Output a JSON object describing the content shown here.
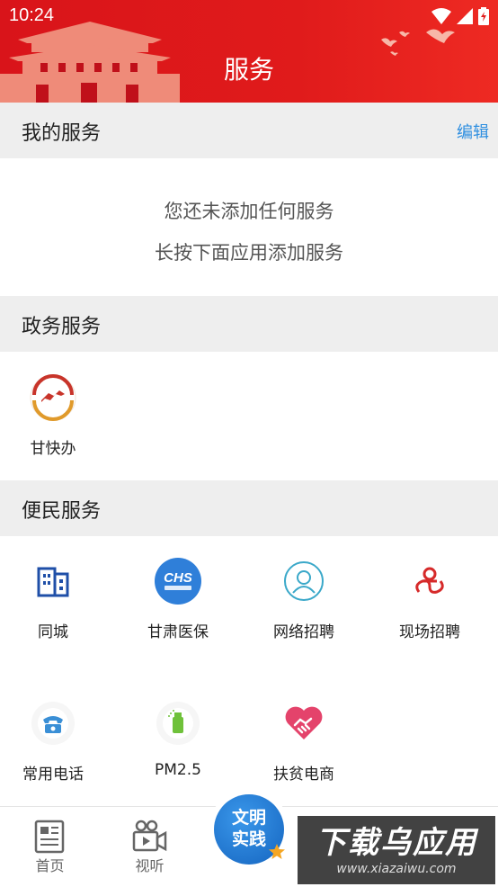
{
  "status_bar": {
    "time": "10:24"
  },
  "header": {
    "title": "服务"
  },
  "my_services": {
    "title": "我的服务",
    "edit_label": "编辑",
    "empty_line1": "您还未添加任何服务",
    "empty_line2": "长按下面应用添加服务"
  },
  "gov_services": {
    "title": "政务服务",
    "apps": [
      {
        "label": "甘快办",
        "icon": "gankuaiban-logo-icon"
      }
    ]
  },
  "civil_services": {
    "title": "便民服务",
    "apps": [
      {
        "label": "同城",
        "icon": "building-icon"
      },
      {
        "label": "甘肃医保",
        "icon": "chs-logo-icon"
      },
      {
        "label": "网络招聘",
        "icon": "person-circle-icon"
      },
      {
        "label": "现场招聘",
        "icon": "recruit-logo-icon"
      },
      {
        "label": "常用电话",
        "icon": "telephone-icon"
      },
      {
        "label": "PM2.5",
        "icon": "air-purifier-icon"
      },
      {
        "label": "扶贫电商",
        "icon": "heart-handshake-icon"
      }
    ]
  },
  "center_button": {
    "line1": "文明",
    "line2": "实践"
  },
  "tabbar": {
    "tabs": [
      {
        "label": "首页",
        "icon": "newspaper-icon"
      },
      {
        "label": "视听",
        "icon": "video-camera-icon"
      }
    ]
  },
  "watermark": {
    "big": "下载乌应用",
    "small": "www.xiazaiwu.com"
  },
  "colors": {
    "header_red": "#e01b1b",
    "link_blue": "#2f8fe0",
    "section_bg": "#eeeeee"
  }
}
